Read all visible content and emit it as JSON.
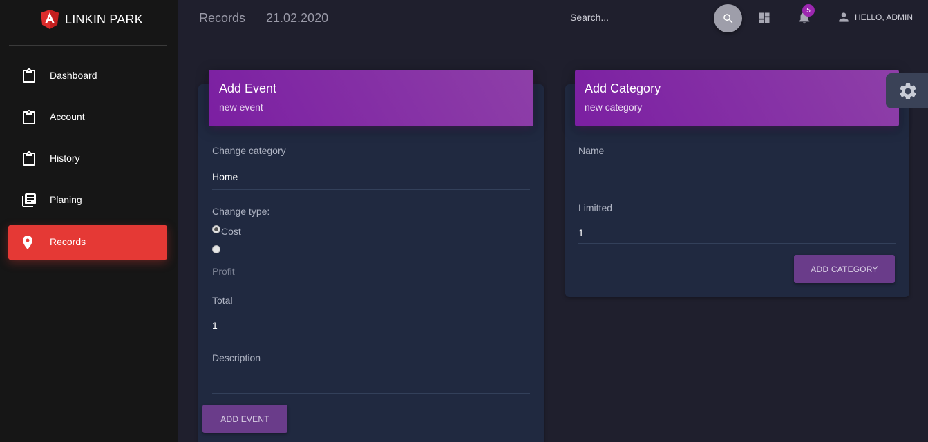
{
  "brand": {
    "name": "LINKIN PARK"
  },
  "sidebar": {
    "items": [
      {
        "label": "Dashboard",
        "icon": "clipboard-icon"
      },
      {
        "label": "Account",
        "icon": "clipboard-icon"
      },
      {
        "label": "History",
        "icon": "clipboard-icon"
      },
      {
        "label": "Planing",
        "icon": "library-books-icon"
      },
      {
        "label": "Records",
        "icon": "location-pin-icon",
        "active": true
      }
    ]
  },
  "header": {
    "breadcrumb": "Records",
    "date": "21.02.2020",
    "search_placeholder": "Search...",
    "notifications_count": "5",
    "user_greeting": "HELLO, ADMIN"
  },
  "add_event": {
    "title": "Add Event",
    "subtitle": "new event",
    "category_label": "Change category",
    "category_value": "Home",
    "type_label": "Change type:",
    "type_options": [
      "Cost",
      "Profit"
    ],
    "type_selected": "Cost",
    "total_label": "Total",
    "total_value": "1",
    "description_label": "Description",
    "description_value": "",
    "submit_label": "ADD EVENT"
  },
  "add_category": {
    "title": "Add Category",
    "subtitle": "new category",
    "name_label": "Name",
    "name_value": "",
    "limit_label": "Limitted",
    "limit_value": "1",
    "submit_label": "ADD CATEGORY"
  },
  "colors": {
    "sidebar_bg": "#161616",
    "page_bg": "#1f1f2d",
    "card_bg": "#202940",
    "active_nav": "#e53935",
    "card_header": "#8e24aa",
    "button": "#6a3c8a"
  }
}
